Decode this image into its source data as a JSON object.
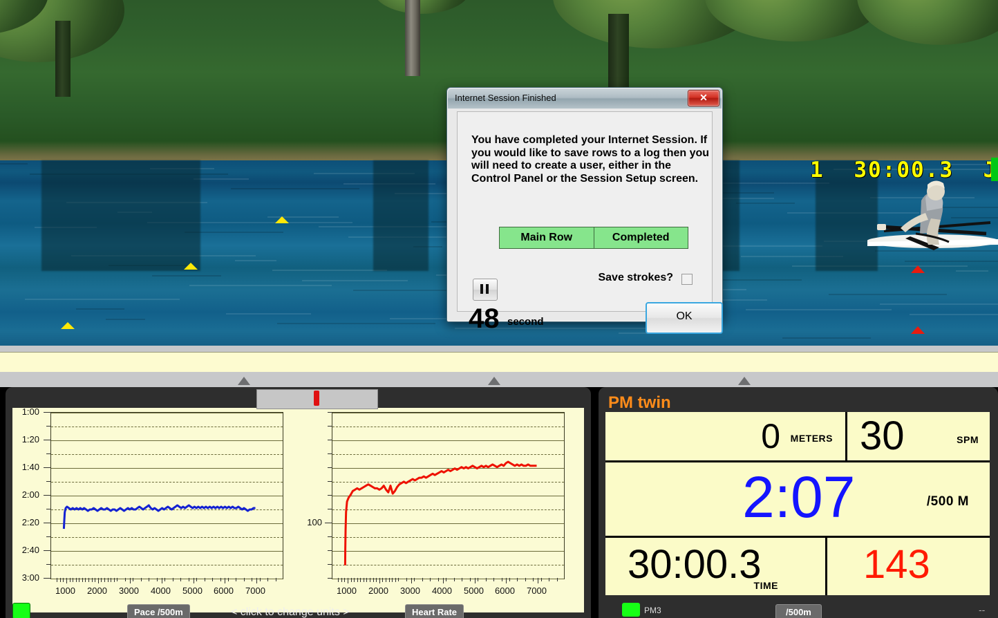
{
  "scene": {
    "race_hud": {
      "lane": "1",
      "time": "30:00.3",
      "initials": "JN"
    }
  },
  "dialog": {
    "title": "Internet Session Finished",
    "close_label": "✕",
    "message": "You have completed your Internet Session.  If you would like to save rows to a log then you will need to create a user, either in the Control Panel or the Session Setup screen.",
    "session_row": {
      "name": "Main Row",
      "status": "Completed"
    },
    "save_strokes_label": "Save strokes?",
    "pause_icon": "pause-icon",
    "countdown_value": "48",
    "countdown_unit": "second",
    "ok_label": "OK"
  },
  "charts": {
    "units_hint": "<  click to change units  >",
    "pace_button": "Pace /500m",
    "hr_button": "Heart Rate"
  },
  "pm": {
    "title": "PM twin",
    "distance": {
      "value": "0",
      "unit": "METERS"
    },
    "stroke_rate": {
      "value": "30",
      "unit": "SPM"
    },
    "pace": {
      "value": "2:07",
      "unit": "/500 M"
    },
    "elapsed": {
      "value": "30:00.3",
      "unit": "TIME"
    },
    "heart_rate": {
      "value": "143"
    },
    "footer": {
      "device": "PM3",
      "units_button": "/500m",
      "right_dash": "--"
    },
    "colors": {
      "pace": "#1414ff",
      "heart_rate": "#ff1a00",
      "title": "#ff8c1a",
      "screen": "#fbfbc8"
    }
  },
  "chart_data": [
    {
      "type": "line",
      "title": "Pace /500m",
      "xlabel": "",
      "ylabel": "",
      "ylim": [
        "1:00",
        "3:00"
      ],
      "y_ticks": [
        "1:00",
        "1:20",
        "1:40",
        "2:00",
        "2:20",
        "2:40",
        "3:00"
      ],
      "xlim": [
        500,
        7800
      ],
      "x_ticks": [
        1000,
        2000,
        3000,
        4000,
        5000,
        6000,
        7000
      ],
      "x_tick_labels": [
        "1000",
        "2000",
        "3000",
        "4000",
        "5000",
        "6000",
        "7000"
      ],
      "grid": true,
      "series": [
        {
          "name": "Pace",
          "color": "#1422d2",
          "x": [
            900,
            915,
            930,
            960,
            1000,
            1060,
            1120,
            1180,
            1240,
            1300,
            1360,
            1420,
            1480,
            1540,
            1600,
            1660,
            1720,
            1780,
            1840,
            1900,
            1960,
            2020,
            2080,
            2140,
            2200,
            2260,
            2320,
            2380,
            2440,
            2500,
            2560,
            2620,
            2680,
            2740,
            2800,
            2860,
            2920,
            2980,
            3040,
            3100,
            3160,
            3220,
            3280,
            3340,
            3400,
            3460,
            3520,
            3580,
            3640,
            3700,
            3760,
            3820,
            3880,
            3940,
            4000,
            4060,
            4120,
            4180,
            4240,
            4300,
            4360,
            4420,
            4480,
            4540,
            4600,
            4660,
            4720,
            4780,
            4840,
            4900,
            4960,
            5020,
            5080,
            5140,
            5200,
            5260,
            5320,
            5380,
            5440,
            5500,
            5560,
            5620,
            5680,
            5740,
            5800,
            5860,
            5920,
            5980,
            6040,
            6100,
            6160,
            6220,
            6280,
            6340,
            6400,
            6460,
            6520,
            6580,
            6640,
            6700,
            6760,
            6820,
            6880,
            6940
          ],
          "y": [
            "2:24",
            "2:18",
            "2:12",
            "2:09",
            "2:08",
            "2:09",
            "2:10",
            "2:09",
            "2:10",
            "2:09",
            "2:10",
            "2:09",
            "2:10",
            "2:09",
            "2:10",
            "2:11",
            "2:10",
            "2:10",
            "2:09",
            "2:10",
            "2:11",
            "2:10",
            "2:09",
            "2:10",
            "2:10",
            "2:09",
            "2:10",
            "2:11",
            "2:10",
            "2:10",
            "2:11",
            "2:10",
            "2:09",
            "2:10",
            "2:11",
            "2:10",
            "2:09",
            "2:10",
            "2:09",
            "2:10",
            "2:10",
            "2:09",
            "2:08",
            "2:09",
            "2:10",
            "2:09",
            "2:08",
            "2:07",
            "2:09",
            "2:10",
            "2:09",
            "2:10",
            "2:11",
            "2:10",
            "2:09",
            "2:10",
            "2:09",
            "2:08",
            "2:09",
            "2:10",
            "2:09",
            "2:08",
            "2:07",
            "2:08",
            "2:09",
            "2:08",
            "2:09",
            "2:08",
            "2:07",
            "2:08",
            "2:09",
            "2:08",
            "2:09",
            "2:08",
            "2:09",
            "2:08",
            "2:09",
            "2:08",
            "2:09",
            "2:08",
            "2:09",
            "2:08",
            "2:09",
            "2:08",
            "2:09",
            "2:08",
            "2:09",
            "2:08",
            "2:09",
            "2:08",
            "2:09",
            "2:08",
            "2:09",
            "2:09",
            "2:08",
            "2:09",
            "2:10",
            "2:09",
            "2:10",
            "2:11",
            "2:10",
            "2:10",
            "2:09",
            "2:09"
          ]
        }
      ]
    },
    {
      "type": "line",
      "title": "Heart Rate",
      "xlabel": "",
      "ylabel": "",
      "y_ticks": [
        "100"
      ],
      "ylim": [
        60,
        185
      ],
      "xlim": [
        500,
        7800
      ],
      "x_ticks": [
        1000,
        2000,
        3000,
        4000,
        5000,
        6000,
        7000
      ],
      "x_tick_labels": [
        "1000",
        "2000",
        "3000",
        "4000",
        "5000",
        "6000",
        "7000"
      ],
      "grid": true,
      "series": [
        {
          "name": "Heart Rate",
          "color": "#ee1100",
          "x": [
            900,
            905,
            915,
            930,
            960,
            1010,
            1070,
            1140,
            1210,
            1280,
            1350,
            1420,
            1490,
            1560,
            1630,
            1700,
            1770,
            1840,
            1910,
            1980,
            2050,
            2120,
            2190,
            2260,
            2330,
            2400,
            2470,
            2540,
            2610,
            2680,
            2750,
            2820,
            2890,
            2960,
            3030,
            3100,
            3170,
            3240,
            3310,
            3380,
            3450,
            3520,
            3590,
            3660,
            3730,
            3800,
            3870,
            3940,
            4010,
            4080,
            4150,
            4220,
            4290,
            4360,
            4430,
            4500,
            4570,
            4640,
            4710,
            4780,
            4850,
            4920,
            4990,
            5060,
            5130,
            5200,
            5270,
            5340,
            5410,
            5480,
            5550,
            5620,
            5690,
            5760,
            5830,
            5900,
            5970,
            6040,
            6110,
            6180,
            6250,
            6320,
            6390,
            6460,
            6530,
            6600,
            6670,
            6740,
            6810,
            6880,
            6940
          ],
          "y": [
            70,
            82,
            96,
            110,
            118,
            121,
            123,
            126,
            127,
            128,
            127,
            128,
            129,
            130,
            131,
            130,
            129,
            128,
            128,
            127,
            128,
            130,
            127,
            125,
            130,
            124,
            126,
            129,
            131,
            132,
            133,
            132,
            133,
            134,
            135,
            134,
            135,
            136,
            136,
            137,
            136,
            137,
            138,
            139,
            138,
            139,
            140,
            141,
            140,
            141,
            142,
            141,
            142,
            143,
            142,
            143,
            144,
            143,
            144,
            143,
            144,
            145,
            144,
            143,
            144,
            145,
            144,
            145,
            144,
            145,
            146,
            145,
            144,
            145,
            146,
            145,
            147,
            148,
            147,
            146,
            145,
            146,
            145,
            146,
            145,
            145,
            146,
            145,
            145,
            145,
            145
          ]
        }
      ]
    }
  ]
}
